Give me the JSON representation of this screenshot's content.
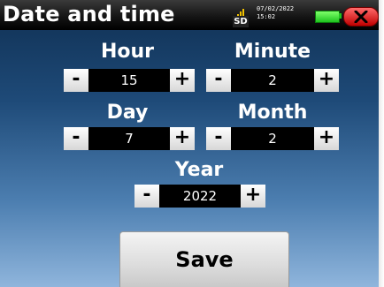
{
  "header": {
    "title": "Date and time",
    "sd_label": "SD",
    "date": "07/02/2022",
    "time": "15:02"
  },
  "fields": {
    "hour": {
      "label": "Hour",
      "minus": "-",
      "plus": "+",
      "value": "15"
    },
    "minute": {
      "label": "Minute",
      "minus": "-",
      "plus": "+",
      "value": "2"
    },
    "day": {
      "label": "Day",
      "minus": "-",
      "plus": "+",
      "value": "7"
    },
    "month": {
      "label": "Month",
      "minus": "-",
      "plus": "+",
      "value": "2"
    },
    "year": {
      "label": "Year",
      "minus": "-",
      "plus": "+",
      "value": "2022"
    }
  },
  "save_label": "Save",
  "icons": {
    "storage": "sd-card-icon",
    "battery": "battery-icon",
    "close": "close-icon"
  },
  "colors": {
    "battery": "#1fc41f",
    "close": "#d40000",
    "sd_signal": "#f2c200"
  }
}
